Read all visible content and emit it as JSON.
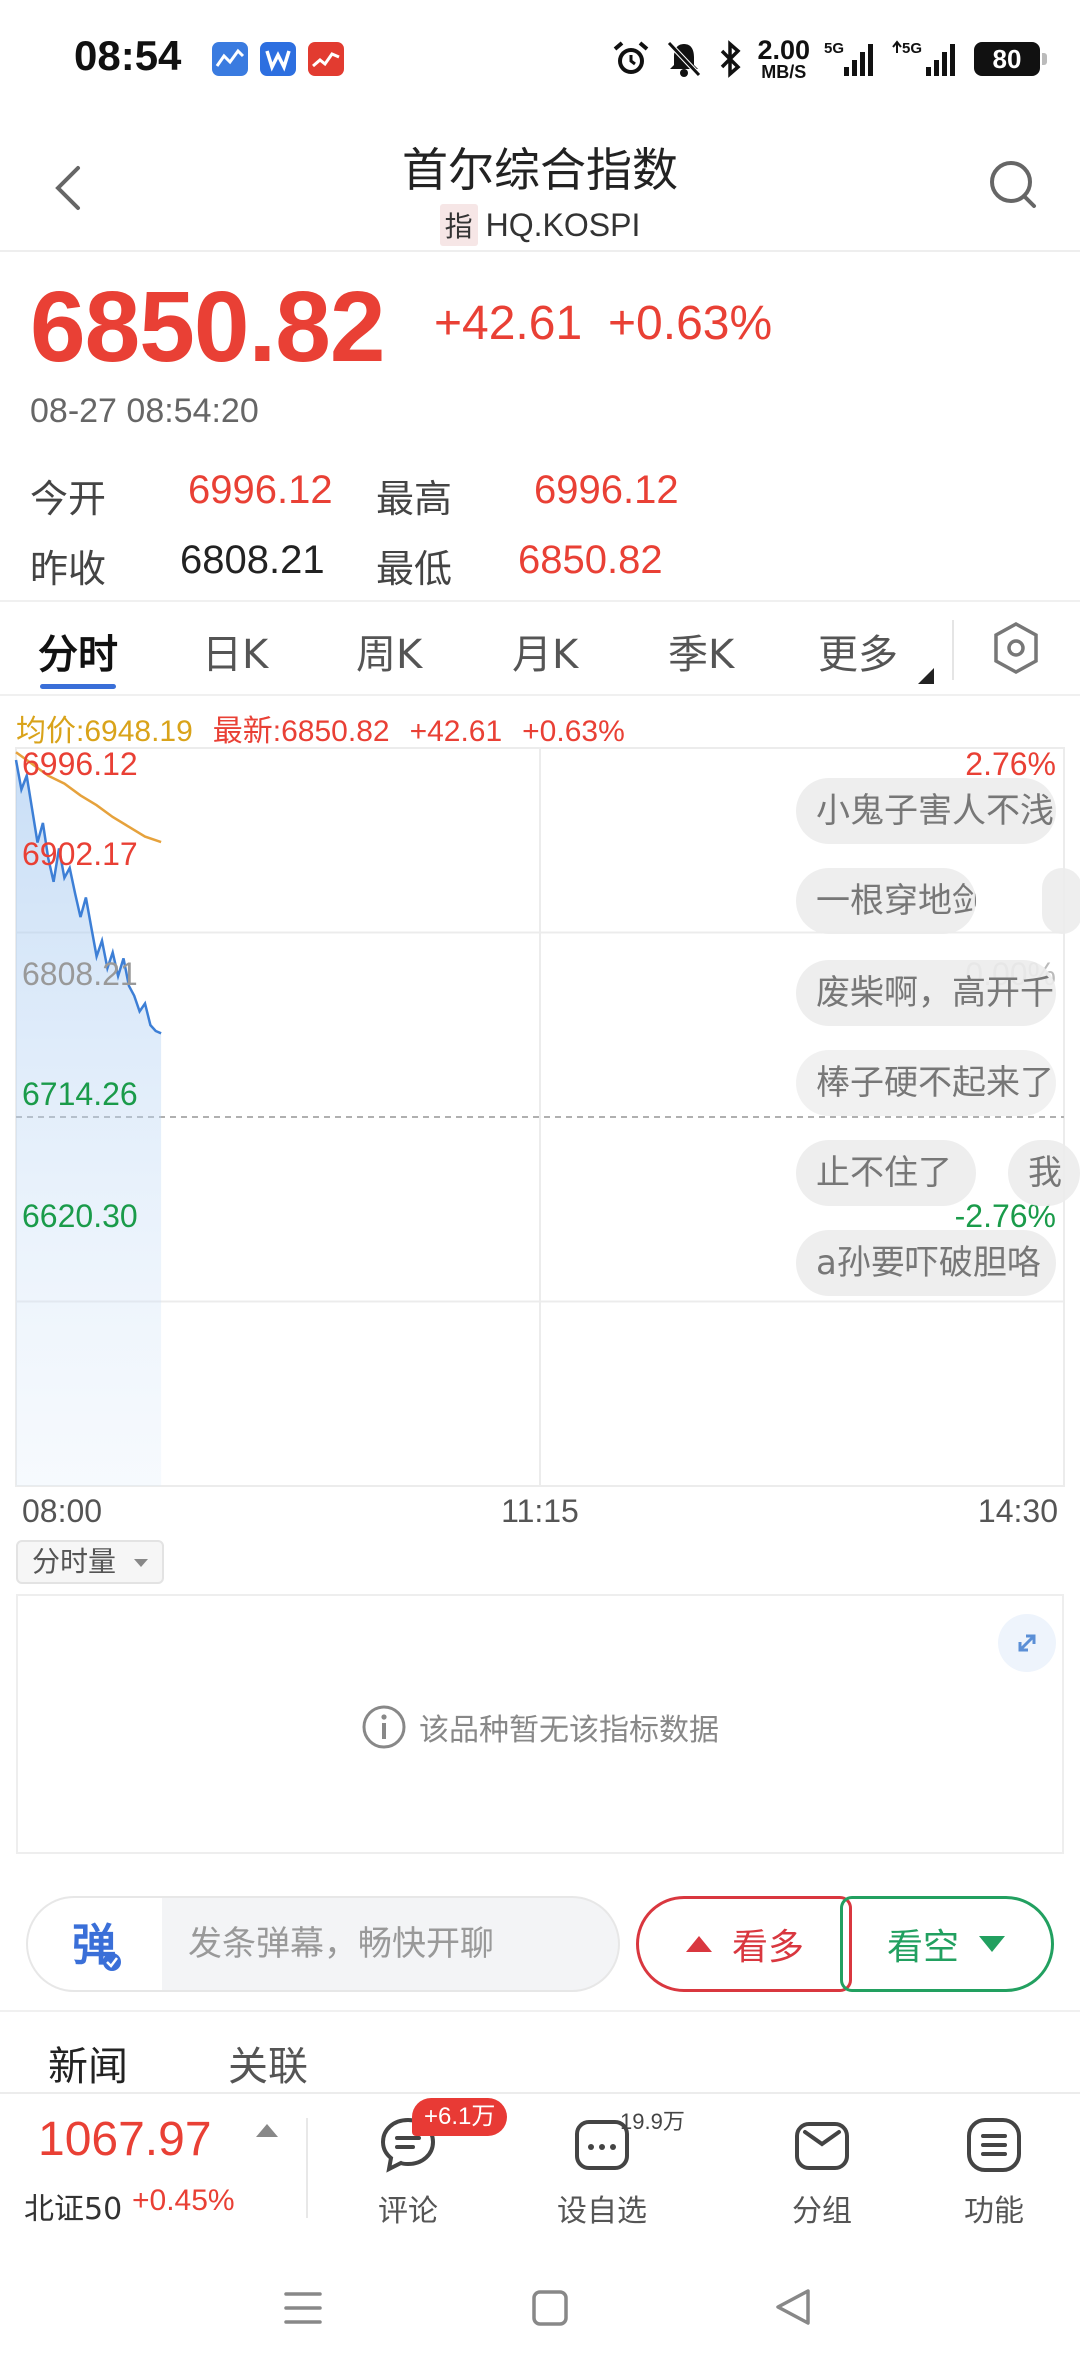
{
  "status_bar": {
    "time": "08:54",
    "net_speed_value": "2.00",
    "net_speed_unit": "MB/S",
    "net_type_1": "5G",
    "net_type_2": "5G",
    "battery": "80"
  },
  "header": {
    "title": "首尔综合指数",
    "tag": "指",
    "code": "HQ.KOSPI"
  },
  "quote": {
    "price": "6850.82",
    "change": "+42.61",
    "change_pct": "+0.63%",
    "datetime": "08-27 08:54:20",
    "open_label": "今开",
    "open": "6996.12",
    "high_label": "最高",
    "high": "6996.12",
    "prev_close_label": "昨收",
    "prev_close": "6808.21",
    "low_label": "最低",
    "low": "6850.82"
  },
  "tabs": [
    {
      "label": "分时",
      "active": true
    },
    {
      "label": "日K",
      "active": false
    },
    {
      "label": "周K",
      "active": false
    },
    {
      "label": "月K",
      "active": false
    },
    {
      "label": "季K",
      "active": false
    },
    {
      "label": "更多",
      "active": false
    }
  ],
  "legend": {
    "avg": "均价:6948.19",
    "latest": "最新:6850.82",
    "change": "+42.61",
    "change_pct": "+0.63%"
  },
  "colors": {
    "up": "#e94035",
    "down": "#1a9b4a",
    "price_line": "#3d7fd6",
    "avg_line": "#e6a23c",
    "accent": "#3a6fd8"
  },
  "chart_data": {
    "type": "line",
    "y_axis_left": [
      "6996.12",
      "6902.17",
      "6808.21",
      "6714.26",
      "6620.30"
    ],
    "y_axis_right": [
      "2.76%",
      "0.00%",
      "-2.76%"
    ],
    "x_axis": [
      "08:00",
      "11:15",
      "14:30"
    ],
    "x_range_minutes": [
      0,
      390
    ],
    "ylim": [
      6620.3,
      6996.12
    ],
    "reference": 6808.21,
    "series": [
      {
        "x": [
          0,
          2,
          4,
          6,
          8,
          10,
          12,
          14,
          16,
          18,
          20,
          22,
          24,
          26,
          28,
          30,
          32,
          34,
          36,
          38,
          40,
          42,
          44,
          46,
          48,
          50,
          52,
          54
        ],
        "values": [
          6990,
          6975,
          6982,
          6965,
          6948,
          6958,
          6940,
          6928,
          6945,
          6930,
          6935,
          6922,
          6910,
          6920,
          6905,
          6890,
          6898,
          6884,
          6892,
          6880,
          6889,
          6875,
          6870,
          6862,
          6866,
          6855,
          6852,
          6850.82
        ]
      },
      {
        "x": [
          0,
          6,
          12,
          18,
          24,
          30,
          36,
          42,
          48,
          54
        ],
        "values": [
          6994,
          6988,
          6982,
          6978,
          6972,
          6967,
          6961,
          6956,
          6951,
          6948.19
        ]
      }
    ],
    "grid": true
  },
  "danmaku": [
    "小鬼子害人不浅",
    "一根穿地剑",
    "废柴啊，高开千",
    "棒子硬不起来了",
    "止不住了",
    "我",
    "a孙要吓破胆咯"
  ],
  "volume": {
    "selector": "分时量",
    "no_data": "该品种暂无该指标数据"
  },
  "input_row": {
    "danmu_icon": "弹",
    "placeholder": "发条弹幕，畅快开聊",
    "bull": "看多",
    "bear": "看空"
  },
  "news_tabs": [
    "新闻",
    "关联"
  ],
  "bottom_bar": {
    "ticker_price": "1067.97",
    "ticker_name": "北证50",
    "ticker_pct": "+0.45%",
    "comment_label": "评论",
    "comment_badge": "+6.1万",
    "watch_label": "设自选",
    "watch_count": "19.9万",
    "group_label": "分组",
    "function_label": "功能"
  }
}
